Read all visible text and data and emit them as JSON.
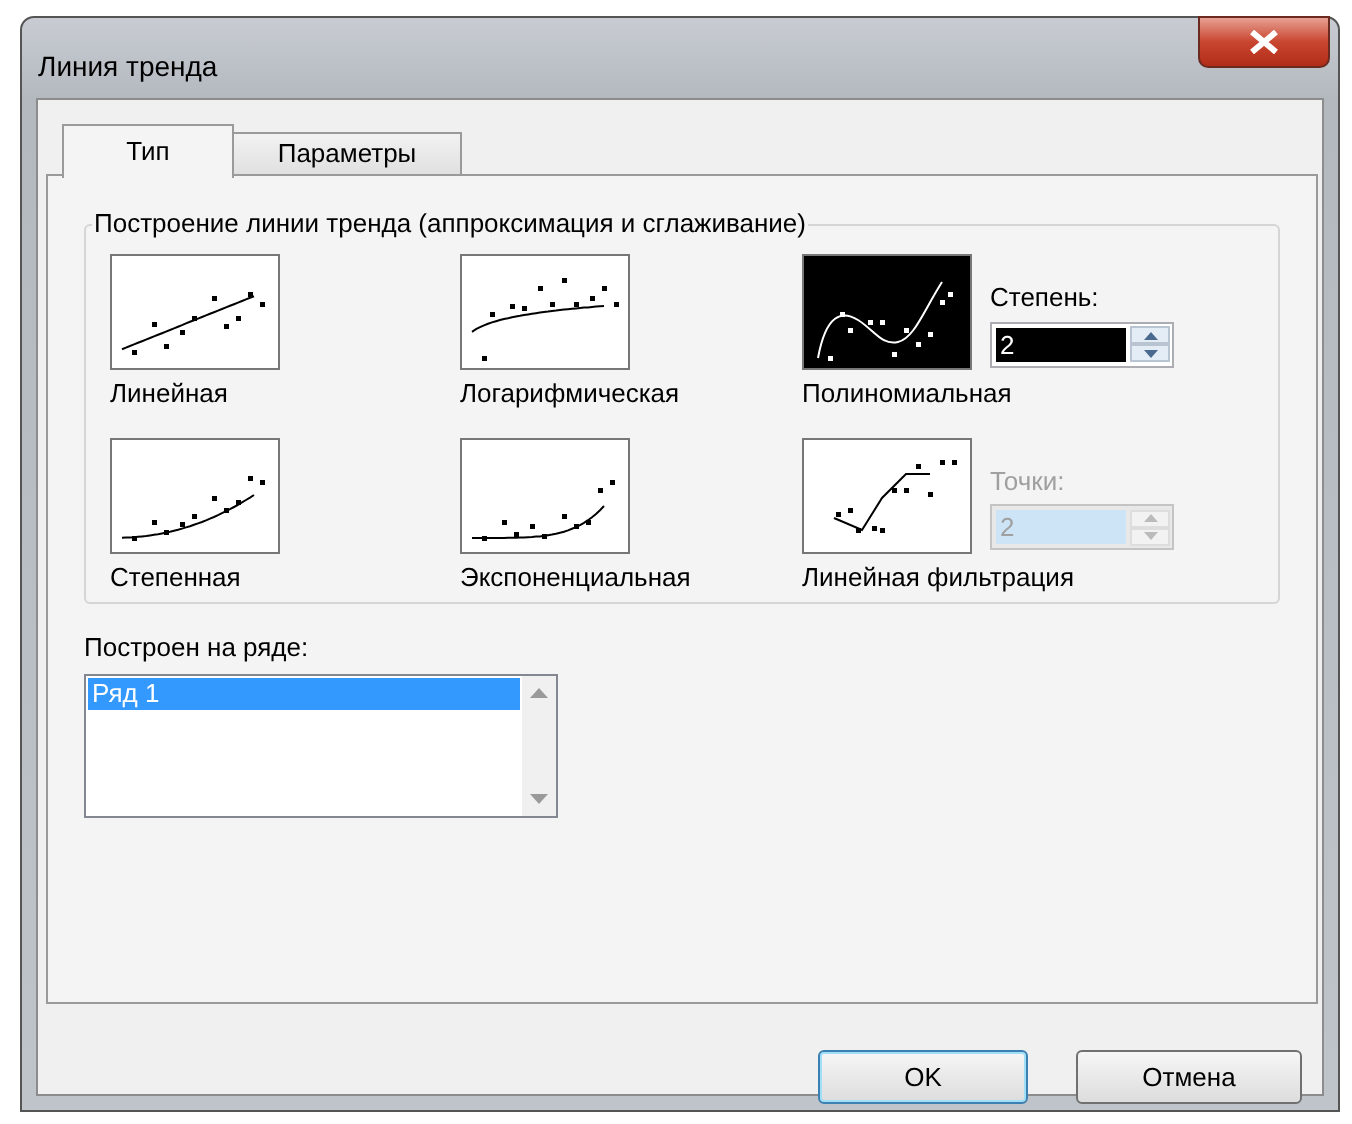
{
  "window": {
    "title": "Линия тренда"
  },
  "tabs": [
    {
      "label": "Тип",
      "selected": true
    },
    {
      "label": "Параметры",
      "selected": false
    }
  ],
  "trend_group": {
    "legend": "Построение линии тренда (аппроксимация и сглаживание)",
    "types": [
      {
        "kind": "linear",
        "label": "Линейная",
        "selected": false
      },
      {
        "kind": "logarithmic",
        "label": "Логарифмическая",
        "selected": false
      },
      {
        "kind": "polynomial",
        "label": "Полиномиальная",
        "selected": true
      },
      {
        "kind": "power",
        "label": "Степенная",
        "selected": false
      },
      {
        "kind": "exponential",
        "label": "Экспоненциальная",
        "selected": false
      },
      {
        "kind": "moving_average",
        "label": "Линейная фильтрация",
        "selected": false
      }
    ],
    "options": [
      {
        "label": "Степень:",
        "value": "2",
        "disabled": false
      },
      {
        "label": "Точки:",
        "value": "2",
        "disabled": true
      }
    ]
  },
  "series_list": {
    "label": "Построен на ряде:",
    "items": [
      {
        "label": "Ряд 1",
        "selected": true
      }
    ]
  },
  "buttons": [
    {
      "label": "OK",
      "default": true
    },
    {
      "label": "Отмена",
      "default": false
    }
  ]
}
